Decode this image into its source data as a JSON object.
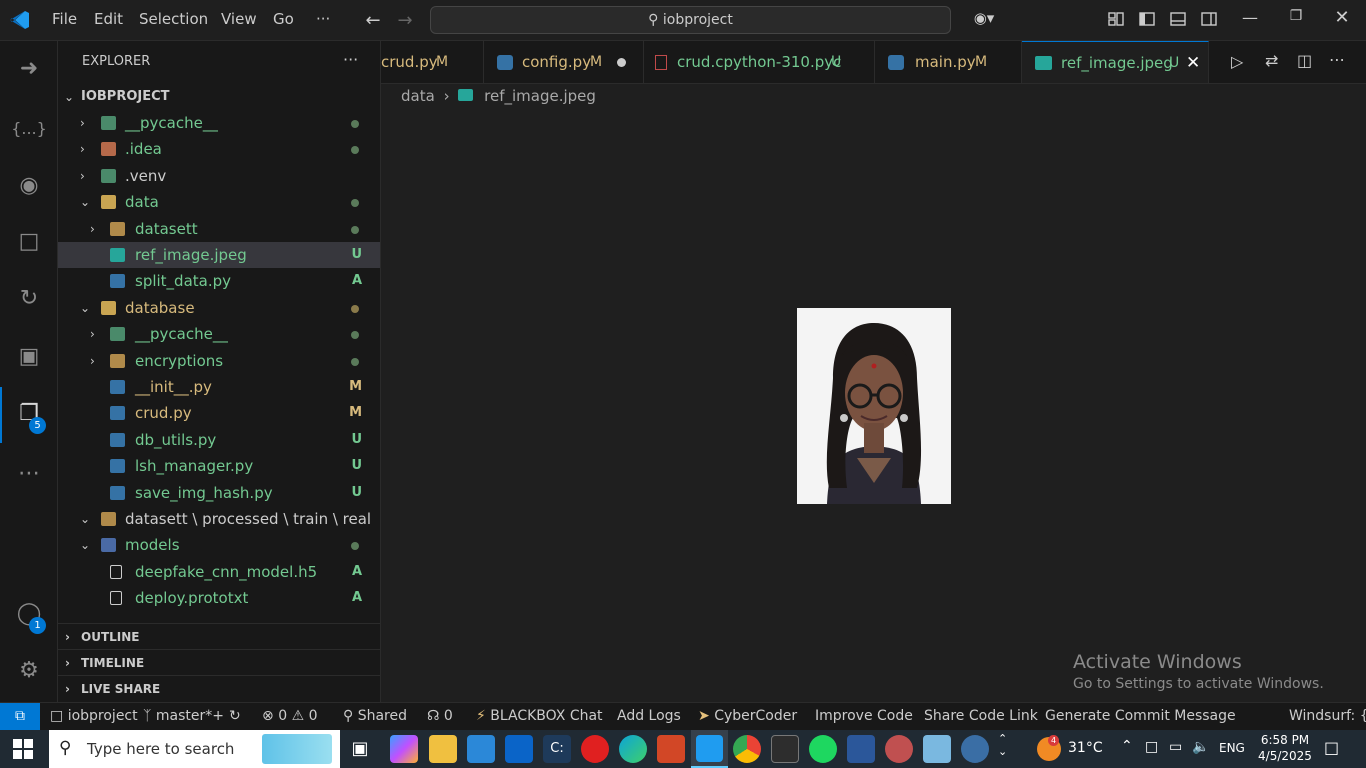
{
  "titlebar": {
    "menus": [
      "File",
      "Edit",
      "Selection",
      "View",
      "Go",
      "···"
    ],
    "search_text": "iobproject"
  },
  "activity_bar": {
    "explorer_badge": "5",
    "account_badge": "1"
  },
  "explorer": {
    "title": "EXPLORER",
    "more": "···",
    "root": "IOBPROJECT",
    "items": [
      {
        "label": "__pycache__",
        "status": "",
        "dot": true
      },
      {
        "label": ".idea",
        "status": "",
        "dot": true
      },
      {
        "label": ".venv",
        "status": "",
        "dot": false
      },
      {
        "label": "data",
        "status": "",
        "dot": true
      },
      {
        "label": "datasett",
        "status": "",
        "dot": true
      },
      {
        "label": "ref_image.jpeg",
        "status": "U",
        "dot": false
      },
      {
        "label": "split_data.py",
        "status": "A",
        "dot": false
      },
      {
        "label": "database",
        "status": "",
        "dot": true
      },
      {
        "label": "__pycache__",
        "status": "",
        "dot": true
      },
      {
        "label": "encryptions",
        "status": "",
        "dot": true
      },
      {
        "label": "__init__.py",
        "status": "M",
        "dot": false
      },
      {
        "label": "crud.py",
        "status": "M",
        "dot": false
      },
      {
        "label": "db_utils.py",
        "status": "U",
        "dot": false
      },
      {
        "label": "lsh_manager.py",
        "status": "U",
        "dot": false
      },
      {
        "label": "save_img_hash.py",
        "status": "U",
        "dot": false
      },
      {
        "label": "datasett \\ processed \\ train \\ real",
        "status": "",
        "dot": false
      },
      {
        "label": "models",
        "status": "",
        "dot": true
      },
      {
        "label": "deepfake_cnn_model.h5",
        "status": "A",
        "dot": false
      },
      {
        "label": "deploy.prototxt",
        "status": "A",
        "dot": false
      }
    ],
    "sections": [
      "OUTLINE",
      "TIMELINE",
      "LIVE SHARE"
    ]
  },
  "tabs": [
    {
      "label": "crud.py",
      "status": "M"
    },
    {
      "label": "config.py",
      "status": "M"
    },
    {
      "label": "crud.cpython-310.pyc",
      "status": "U"
    },
    {
      "label": "main.py",
      "status": "M"
    },
    {
      "label": "ref_image.jpeg",
      "status": "U"
    }
  ],
  "breadcrumb": {
    "folder": "data",
    "file": "ref_image.jpeg"
  },
  "watermark": {
    "title": "Activate Windows",
    "subtitle": "Go to Settings to activate Windows."
  },
  "statusbar": {
    "project": "iobproject",
    "branch": "master*+",
    "errors": "0",
    "warnings": "0",
    "shared": "Shared",
    "ports": "0",
    "blackbox": "BLACKBOX Chat",
    "add_logs": "Add Logs",
    "cybercoder": "CyberCoder",
    "improve": "Improve Code",
    "share_link": "Share Code Link",
    "commit": "Generate Commit Message",
    "windsurf": "Windsurf: {..."
  },
  "taskbar": {
    "search_placeholder": "Type here to search",
    "weather": "31°C",
    "weather_badge": "4",
    "lang": "ENG",
    "time": "6:58 PM",
    "date": "4/5/2025"
  },
  "colors": {
    "accent": "#0078d4",
    "modified": "#d7ba7d",
    "untracked": "#73c991",
    "git_dot": "#5a7a5a"
  }
}
